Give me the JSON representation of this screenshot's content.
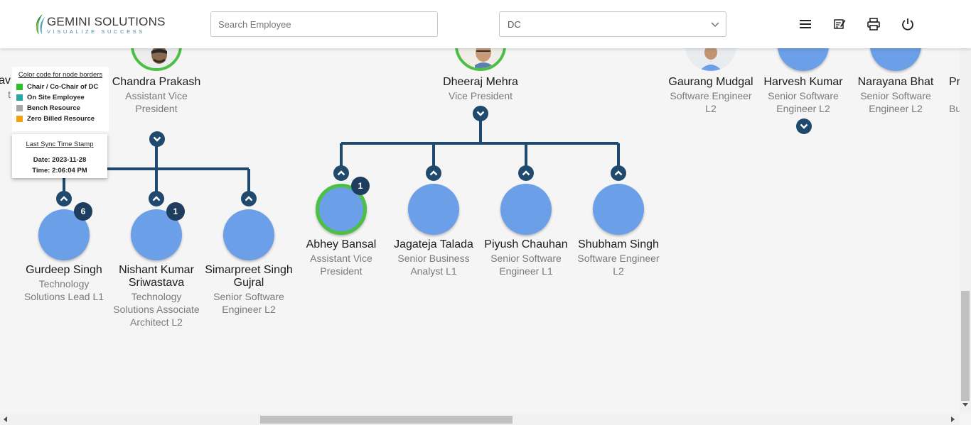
{
  "header": {
    "logo_name": "GEMINI SOLUTIONS",
    "logo_tagline": "VISUALIZE SUCCESS",
    "search_placeholder": "Search Employee",
    "select_value": "DC"
  },
  "legend": {
    "title": "Color code for node borders",
    "items": [
      {
        "label": "Chair / Co-Chair of DC",
        "color": "#2fbf2a"
      },
      {
        "label": "On Site Employee",
        "color": "#2aa6a0"
      },
      {
        "label": "Bench Resource",
        "color": "#a6a6a6"
      },
      {
        "label": "Zero Billed Resource",
        "color": "#f2a20c"
      }
    ]
  },
  "sync": {
    "title": "Last Sync Time Stamp",
    "date": "Date: 2023-11-28",
    "time": "Time: 2:06:04 PM"
  },
  "colors": {
    "node_fill": "#6b9fe7",
    "chair_border": "#4cbf45",
    "connector": "#1f4a6d",
    "badge": "#1f3d5e"
  },
  "nodes": {
    "partial_left": {
      "name": "av",
      "title": "t"
    },
    "chandra": {
      "name": "Chandra Prakash",
      "title": "Assistant Vice President"
    },
    "dheeraj": {
      "name": "Dheeraj Mehra",
      "title": "Vice President"
    },
    "gaurang": {
      "name": "Gaurang Mudgal",
      "title": "Software Engineer L2"
    },
    "harvesh": {
      "name": "Harvesh Kumar",
      "title": "Senior Software Engineer L2"
    },
    "narayana": {
      "name": "Narayana Bhat",
      "title": "Senior Software Engineer L2"
    },
    "partial_right": {
      "name": "Pr",
      "title": "Bu"
    },
    "gurdeep": {
      "name": "Gurdeep Singh",
      "title": "Technology Solutions Lead L1",
      "badge": "6"
    },
    "nishant": {
      "name": "Nishant Kumar Sriwastava",
      "title": "Technology Solutions Associate Architect L2",
      "badge": "1"
    },
    "simarpreet": {
      "name": "Simarpreet Singh Gujral",
      "title": "Senior Software Engineer L2"
    },
    "abhey": {
      "name": "Abhey Bansal",
      "title": "Assistant Vice President",
      "badge": "1"
    },
    "jagateja": {
      "name": "Jagateja Talada",
      "title": "Senior Business Analyst L1"
    },
    "piyush": {
      "name": "Piyush Chauhan",
      "title": "Senior Software Engineer L1"
    },
    "shubham": {
      "name": "Shubham Singh",
      "title": "Software Engineer L2"
    }
  }
}
